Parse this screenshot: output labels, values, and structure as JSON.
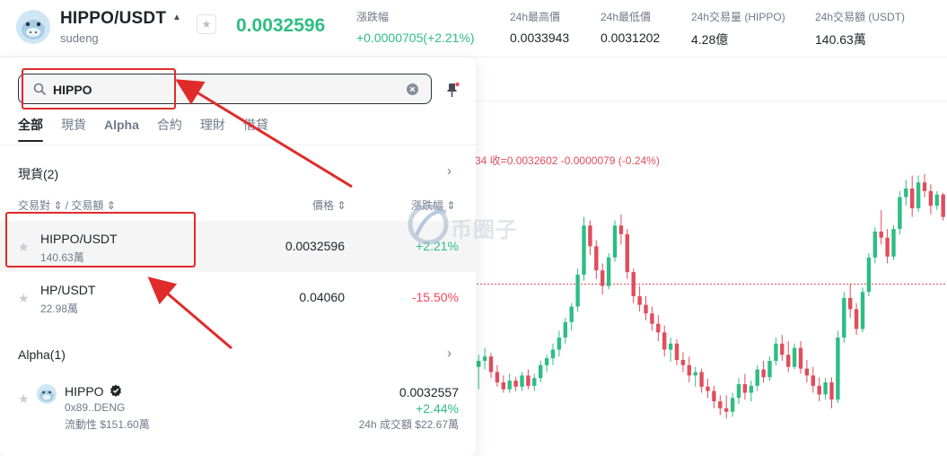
{
  "header": {
    "pair": "HIPPO/USDT",
    "subtitle": "sudeng",
    "last_price": "0.0032596",
    "stats": [
      {
        "label": "漲跌幅",
        "value": "+0.0000705(+2.21%)",
        "tone": "up"
      },
      {
        "label": "24h最高價",
        "value": "0.0033943",
        "tone": "neutral"
      },
      {
        "label": "24h最低價",
        "value": "0.0031202",
        "tone": "neutral"
      },
      {
        "label": "24h交易量 (HIPPO)",
        "value": "4.28億",
        "tone": "neutral"
      },
      {
        "label": "24h交易額 (USDT)",
        "value": "140.63萬",
        "tone": "neutral"
      }
    ]
  },
  "search": {
    "value": "HIPPO",
    "icons": {
      "search": "search-icon",
      "clear": "clear-icon",
      "pin": "pin-icon"
    }
  },
  "tabs": [
    "全部",
    "現貨",
    "Alpha",
    "合約",
    "理財",
    "借貸"
  ],
  "spot_section": {
    "title": "現貨(2)",
    "col_pair": "交易對 ⇕ / 交易額 ⇕",
    "col_price": "價格 ⇕",
    "col_change": "漲跌幅 ⇕",
    "rows": [
      {
        "pair": "HIPPO/USDT",
        "volume": "140.63萬",
        "price": "0.0032596",
        "change": "+2.21%",
        "tone": "up"
      },
      {
        "pair": "HP/USDT",
        "volume": "22.98萬",
        "price": "0.04060",
        "change": "-15.50%",
        "tone": "down"
      }
    ]
  },
  "alpha_section": {
    "title": "Alpha(1)",
    "item": {
      "name": "HIPPO",
      "address": "0x89..DENG",
      "liquidity": "流動性 $151.60萬",
      "price": "0.0032557",
      "change": "+2.44%",
      "volume": "24h 成交額 $22.67萬"
    }
  },
  "chart": {
    "ohlc_readout": "34  收=0.0032602  -0.0000079  (-0.24%)",
    "up_color": "#2ebd85",
    "down_color": "#e04d5c",
    "candles": [
      {
        "o": 0.003198,
        "h": 0.003212,
        "l": 0.003172,
        "c": 0.003205
      },
      {
        "o": 0.003205,
        "h": 0.00322,
        "l": 0.003195,
        "c": 0.00321
      },
      {
        "o": 0.00321,
        "h": 0.003214,
        "l": 0.003185,
        "c": 0.003192
      },
      {
        "o": 0.003192,
        "h": 0.0032,
        "l": 0.003175,
        "c": 0.00318
      },
      {
        "o": 0.00318,
        "h": 0.003188,
        "l": 0.003168,
        "c": 0.003172
      },
      {
        "o": 0.003172,
        "h": 0.00319,
        "l": 0.003168,
        "c": 0.003182
      },
      {
        "o": 0.003182,
        "h": 0.003186,
        "l": 0.00317,
        "c": 0.003175
      },
      {
        "o": 0.003175,
        "h": 0.003192,
        "l": 0.00317,
        "c": 0.003188
      },
      {
        "o": 0.003188,
        "h": 0.003195,
        "l": 0.003172,
        "c": 0.003176
      },
      {
        "o": 0.003176,
        "h": 0.00319,
        "l": 0.00317,
        "c": 0.003185
      },
      {
        "o": 0.003185,
        "h": 0.003205,
        "l": 0.00318,
        "c": 0.0032
      },
      {
        "o": 0.0032,
        "h": 0.003212,
        "l": 0.003192,
        "c": 0.003208
      },
      {
        "o": 0.003208,
        "h": 0.003225,
        "l": 0.0032,
        "c": 0.003218
      },
      {
        "o": 0.003218,
        "h": 0.00324,
        "l": 0.00321,
        "c": 0.003232
      },
      {
        "o": 0.003232,
        "h": 0.003255,
        "l": 0.003225,
        "c": 0.00325
      },
      {
        "o": 0.00325,
        "h": 0.003272,
        "l": 0.00324,
        "c": 0.003268
      },
      {
        "o": 0.003268,
        "h": 0.003312,
        "l": 0.003262,
        "c": 0.003305
      },
      {
        "o": 0.003305,
        "h": 0.003372,
        "l": 0.003298,
        "c": 0.003362
      },
      {
        "o": 0.003362,
        "h": 0.003368,
        "l": 0.003328,
        "c": 0.003338
      },
      {
        "o": 0.003338,
        "h": 0.003345,
        "l": 0.0033,
        "c": 0.00331
      },
      {
        "o": 0.00331,
        "h": 0.003318,
        "l": 0.003282,
        "c": 0.003292
      },
      {
        "o": 0.003292,
        "h": 0.00333,
        "l": 0.003288,
        "c": 0.003325
      },
      {
        "o": 0.003325,
        "h": 0.003368,
        "l": 0.00332,
        "c": 0.003362
      },
      {
        "o": 0.003362,
        "h": 0.003375,
        "l": 0.00334,
        "c": 0.003352
      },
      {
        "o": 0.003352,
        "h": 0.003358,
        "l": 0.0033,
        "c": 0.003308
      },
      {
        "o": 0.003308,
        "h": 0.003312,
        "l": 0.003272,
        "c": 0.00328
      },
      {
        "o": 0.00328,
        "h": 0.003292,
        "l": 0.003262,
        "c": 0.00327
      },
      {
        "o": 0.00327,
        "h": 0.00328,
        "l": 0.003252,
        "c": 0.00326
      },
      {
        "o": 0.00326,
        "h": 0.003268,
        "l": 0.00324,
        "c": 0.003248
      },
      {
        "o": 0.003248,
        "h": 0.003258,
        "l": 0.003228,
        "c": 0.003238
      },
      {
        "o": 0.003238,
        "h": 0.003246,
        "l": 0.00321,
        "c": 0.003218
      },
      {
        "o": 0.003218,
        "h": 0.003232,
        "l": 0.003204,
        "c": 0.003225
      },
      {
        "o": 0.003225,
        "h": 0.00323,
        "l": 0.0032,
        "c": 0.003206
      },
      {
        "o": 0.003206,
        "h": 0.003215,
        "l": 0.003192,
        "c": 0.0032
      },
      {
        "o": 0.0032,
        "h": 0.00321,
        "l": 0.00318,
        "c": 0.003188
      },
      {
        "o": 0.003188,
        "h": 0.003198,
        "l": 0.003175,
        "c": 0.003192
      },
      {
        "o": 0.003192,
        "h": 0.003196,
        "l": 0.003168,
        "c": 0.003175
      },
      {
        "o": 0.003175,
        "h": 0.003184,
        "l": 0.003162,
        "c": 0.00317
      },
      {
        "o": 0.00317,
        "h": 0.003176,
        "l": 0.00315,
        "c": 0.003158
      },
      {
        "o": 0.003158,
        "h": 0.003165,
        "l": 0.003142,
        "c": 0.00315
      },
      {
        "o": 0.00315,
        "h": 0.003165,
        "l": 0.003138,
        "c": 0.003146
      },
      {
        "o": 0.003146,
        "h": 0.003168,
        "l": 0.00314,
        "c": 0.003162
      },
      {
        "o": 0.003162,
        "h": 0.003185,
        "l": 0.003155,
        "c": 0.003178
      },
      {
        "o": 0.003178,
        "h": 0.00319,
        "l": 0.00316,
        "c": 0.003168
      },
      {
        "o": 0.003168,
        "h": 0.003182,
        "l": 0.003158,
        "c": 0.003176
      },
      {
        "o": 0.003176,
        "h": 0.0032,
        "l": 0.00317,
        "c": 0.003195
      },
      {
        "o": 0.003195,
        "h": 0.003205,
        "l": 0.00318,
        "c": 0.003186
      },
      {
        "o": 0.003186,
        "h": 0.00321,
        "l": 0.003182,
        "c": 0.003205
      },
      {
        "o": 0.003205,
        "h": 0.003232,
        "l": 0.0032,
        "c": 0.003225
      },
      {
        "o": 0.003225,
        "h": 0.003235,
        "l": 0.003205,
        "c": 0.003212
      },
      {
        "o": 0.003212,
        "h": 0.003228,
        "l": 0.003192,
        "c": 0.003198
      },
      {
        "o": 0.003198,
        "h": 0.003225,
        "l": 0.003195,
        "c": 0.00322
      },
      {
        "o": 0.00322,
        "h": 0.003228,
        "l": 0.00319,
        "c": 0.003196
      },
      {
        "o": 0.003196,
        "h": 0.003206,
        "l": 0.00318,
        "c": 0.003188
      },
      {
        "o": 0.003188,
        "h": 0.003198,
        "l": 0.003168,
        "c": 0.003176
      },
      {
        "o": 0.003176,
        "h": 0.003186,
        "l": 0.003158,
        "c": 0.003166
      },
      {
        "o": 0.003166,
        "h": 0.003185,
        "l": 0.00316,
        "c": 0.00318
      },
      {
        "o": 0.00318,
        "h": 0.003186,
        "l": 0.00315,
        "c": 0.00316
      },
      {
        "o": 0.00316,
        "h": 0.00324,
        "l": 0.003156,
        "c": 0.003232
      },
      {
        "o": 0.003232,
        "h": 0.003285,
        "l": 0.003226,
        "c": 0.003278
      },
      {
        "o": 0.003278,
        "h": 0.003295,
        "l": 0.003255,
        "c": 0.003265
      },
      {
        "o": 0.003265,
        "h": 0.003272,
        "l": 0.003235,
        "c": 0.003242
      },
      {
        "o": 0.003242,
        "h": 0.00329,
        "l": 0.003238,
        "c": 0.003285
      },
      {
        "o": 0.003285,
        "h": 0.00333,
        "l": 0.00328,
        "c": 0.003325
      },
      {
        "o": 0.003325,
        "h": 0.00336,
        "l": 0.003318,
        "c": 0.003355
      },
      {
        "o": 0.003355,
        "h": 0.00338,
        "l": 0.00334,
        "c": 0.003348
      },
      {
        "o": 0.003348,
        "h": 0.003358,
        "l": 0.003318,
        "c": 0.003326
      },
      {
        "o": 0.003326,
        "h": 0.003362,
        "l": 0.003322,
        "c": 0.003358
      },
      {
        "o": 0.003358,
        "h": 0.003402,
        "l": 0.003352,
        "c": 0.003395
      },
      {
        "o": 0.003395,
        "h": 0.003415,
        "l": 0.003385,
        "c": 0.003405
      },
      {
        "o": 0.003405,
        "h": 0.00342,
        "l": 0.003372,
        "c": 0.003382
      },
      {
        "o": 0.003382,
        "h": 0.00342,
        "l": 0.003378,
        "c": 0.003412
      },
      {
        "o": 0.003412,
        "h": 0.003422,
        "l": 0.003395,
        "c": 0.003402
      },
      {
        "o": 0.003402,
        "h": 0.00341,
        "l": 0.003375,
        "c": 0.003385
      },
      {
        "o": 0.003385,
        "h": 0.003402,
        "l": 0.00338,
        "c": 0.003398
      },
      {
        "o": 0.003398,
        "h": 0.0034,
        "l": 0.003368,
        "c": 0.003372
      }
    ]
  }
}
